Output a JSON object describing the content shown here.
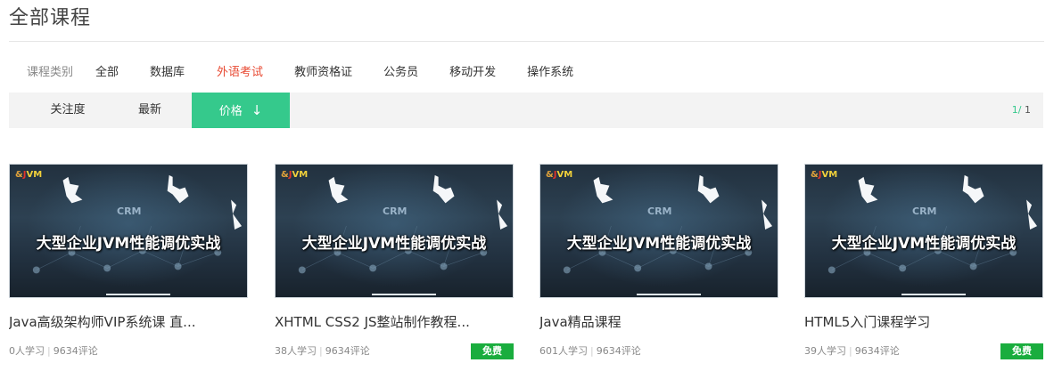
{
  "page": {
    "title": "全部课程"
  },
  "categories": {
    "label": "课程类别",
    "items": [
      {
        "label": "全部",
        "active": false
      },
      {
        "label": "数据库",
        "active": false
      },
      {
        "label": "外语考试",
        "active": true
      },
      {
        "label": "教师资格证",
        "active": false
      },
      {
        "label": "公务员",
        "active": false
      },
      {
        "label": "移动开发",
        "active": false
      },
      {
        "label": "操作系统",
        "active": false
      }
    ]
  },
  "sort": {
    "items": [
      {
        "label": "关注度",
        "active": false
      },
      {
        "label": "最新",
        "active": false
      },
      {
        "label": "价格",
        "active": true,
        "arrow": "↓"
      }
    ],
    "pager": {
      "current": "1",
      "separator": "/ ",
      "total": "1"
    }
  },
  "courses": [
    {
      "thumb_logo": [
        "&",
        "J",
        "VM"
      ],
      "thumb_crm": "CRM",
      "thumb_text": "大型企业JVM性能调优实战",
      "title": "Java高级架构师VIP系统课 直...",
      "learners": "0人学习",
      "comments": "9634评论",
      "badge": ""
    },
    {
      "thumb_logo": [
        "&",
        "J",
        "VM"
      ],
      "thumb_crm": "CRM",
      "thumb_text": "大型企业JVM性能调优实战",
      "title": "XHTML CSS2 JS整站制作教程...",
      "learners": "38人学习",
      "comments": "9634评论",
      "badge": "免费"
    },
    {
      "thumb_logo": [
        "&",
        "J",
        "VM"
      ],
      "thumb_crm": "CRM",
      "thumb_text": "大型企业JVM性能调优实战",
      "title": "Java精品课程",
      "learners": "601人学习",
      "comments": "9634评论",
      "badge": ""
    },
    {
      "thumb_logo": [
        "&",
        "J",
        "VM"
      ],
      "thumb_crm": "CRM",
      "thumb_text": "大型企业JVM性能调优实战",
      "title": "HTML5入门课程学习",
      "learners": "39人学习",
      "comments": "9634评论",
      "badge": "免费"
    }
  ],
  "colors": {
    "accent": "#35c98c",
    "active_category": "#e84a33",
    "badge": "#1aad3e"
  }
}
